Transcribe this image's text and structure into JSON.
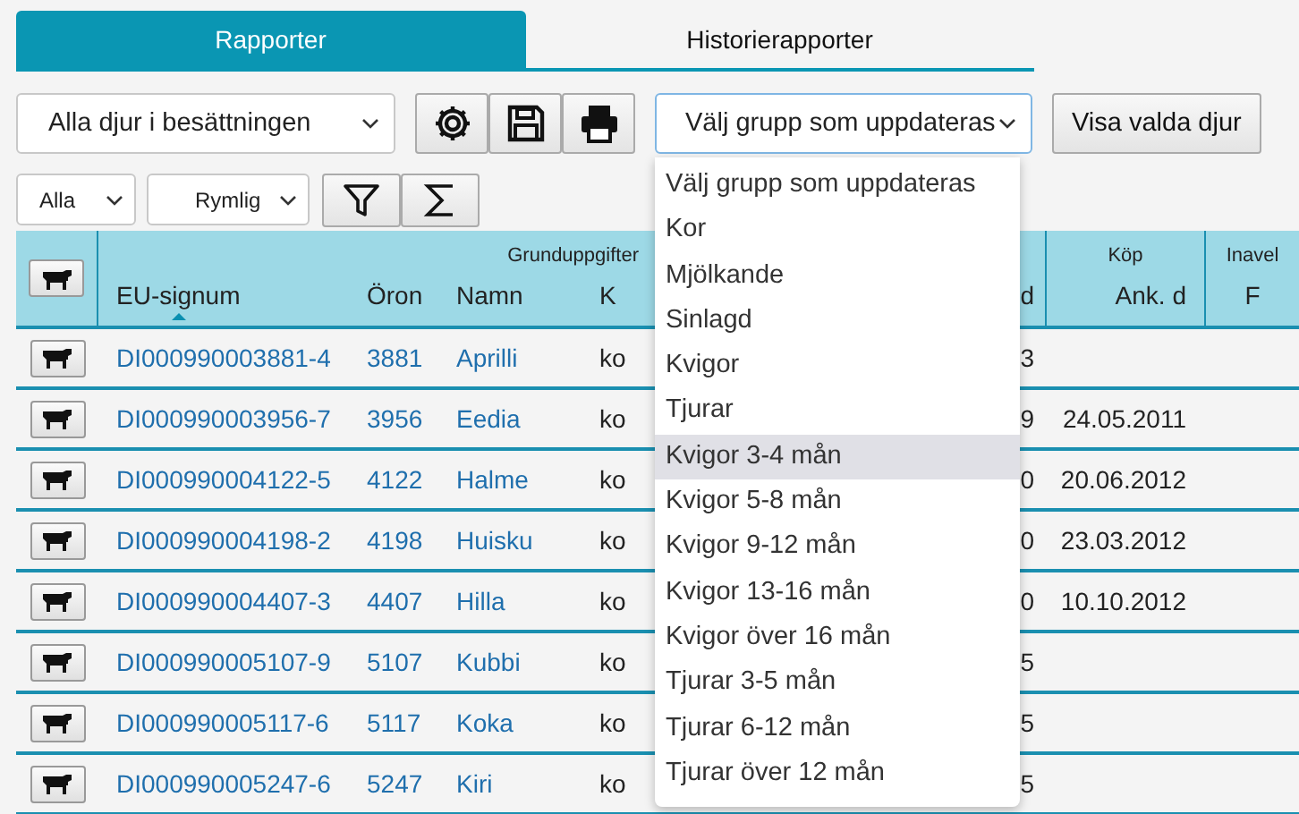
{
  "tabs": [
    {
      "label": "Rapporter",
      "selected": true
    },
    {
      "label": "Historierapporter",
      "selected": false
    }
  ],
  "toolbar": {
    "animal_select": {
      "value": "Alla djur i besättningen"
    },
    "group_select": {
      "value": "Välj grupp som uppdateras",
      "expanded": true
    },
    "show_button": {
      "label": "Visa valda djur"
    }
  },
  "filters": [
    {
      "value": "Alla"
    },
    {
      "value": "Rymlig"
    }
  ],
  "group_options": [
    {
      "label": "Välj grupp som uppdateras",
      "highlighted": false
    },
    {
      "label": "Kor",
      "highlighted": false
    },
    {
      "label": "Mjölkande",
      "highlighted": false
    },
    {
      "label": "Sinlagd",
      "highlighted": false
    },
    {
      "label": "Kvigor",
      "highlighted": false
    },
    {
      "label": "Tjurar",
      "highlighted": false
    },
    {
      "label": "Kvigor 3-4 mån",
      "highlighted": true
    },
    {
      "label": "Kvigor 5-8 mån",
      "highlighted": false
    },
    {
      "label": "Kvigor 9-12 mån",
      "highlighted": false
    },
    {
      "label": "Kvigor 13-16 mån",
      "highlighted": false
    },
    {
      "label": "Kvigor över 16 mån",
      "highlighted": false
    },
    {
      "label": "Tjurar 3-5 mån",
      "highlighted": false
    },
    {
      "label": "Tjurar 6-12 mån",
      "highlighted": false
    },
    {
      "label": "Tjurar över 12 mån",
      "highlighted": false
    }
  ],
  "table": {
    "group_headers": {
      "basic": "Grunduppgifter",
      "purchase": "Köp",
      "inbreeding": "Inavel"
    },
    "columns": [
      {
        "label": "EU-signum",
        "sorted": true
      },
      {
        "label": "Öron",
        "sorted": false
      },
      {
        "label": "Namn",
        "sorted": false
      },
      {
        "label": "K",
        "sorted": false
      },
      {
        "label": "d",
        "sorted": false
      },
      {
        "label": "Ank. d",
        "sorted": false
      },
      {
        "label": "F",
        "sorted": false
      }
    ],
    "rows": [
      {
        "eu_signum": "DI000990003881-4",
        "oron": "3881",
        "namn": "Aprilli",
        "k": "ko",
        "column_5": "3",
        "ank_d": ""
      },
      {
        "eu_signum": "DI000990003956-7",
        "oron": "3956",
        "namn": "Eedia",
        "k": "ko",
        "column_5": "9",
        "ank_d": "24.05.2011"
      },
      {
        "eu_signum": "DI000990004122-5",
        "oron": "4122",
        "namn": "Halme",
        "k": "ko",
        "column_5": "0",
        "ank_d": "20.06.2012"
      },
      {
        "eu_signum": "DI000990004198-2",
        "oron": "4198",
        "namn": "Huisku",
        "k": "ko",
        "column_5": "0",
        "ank_d": "23.03.2012"
      },
      {
        "eu_signum": "DI000990004407-3",
        "oron": "4407",
        "namn": "Hilla",
        "k": "ko",
        "column_5": "0",
        "ank_d": "10.10.2012"
      },
      {
        "eu_signum": "DI000990005107-9",
        "oron": "5107",
        "namn": "Kubbi",
        "k": "ko",
        "column_5": "5",
        "ank_d": ""
      },
      {
        "eu_signum": "DI000990005117-6",
        "oron": "5117",
        "namn": "Koka",
        "k": "ko",
        "column_5": "5",
        "ank_d": ""
      },
      {
        "eu_signum": "DI000990005247-6",
        "oron": "5247",
        "namn": "Kiri",
        "k": "ko",
        "column_5": "5",
        "ank_d": ""
      }
    ]
  }
}
